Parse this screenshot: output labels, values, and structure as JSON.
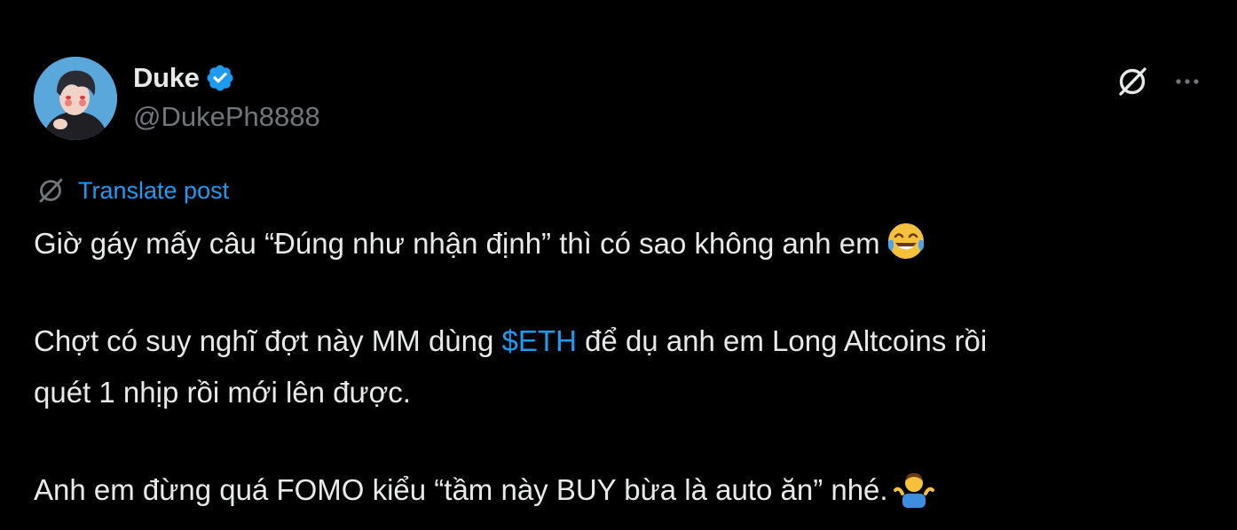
{
  "author": {
    "display_name": "Duke",
    "handle": "@DukePh8888",
    "verified": true
  },
  "actions": {
    "grok_icon": "grok-slash-icon",
    "more_icon": "more-horizontal-icon"
  },
  "translate": {
    "label": "Translate post"
  },
  "post": {
    "line1": "Giờ gáy mấy câu “Đúng như nhận định” thì có sao không anh em",
    "line2_before": "Chợt có suy nghĩ đợt này MM dùng ",
    "cashtag": "$ETH",
    "line2_after": " để dụ anh em Long Altcoins rồi",
    "line3": "quét 1 nhịp rồi mới lên được.",
    "line4": "Anh em đừng quá FOMO kiểu “tầm này BUY bừa là auto ăn” nhé."
  },
  "emojis": {
    "line1": "tears-of-joy-emoji",
    "line4": "shrugging-person-emoji"
  },
  "colors": {
    "background": "#000000",
    "text": "#e7e9ea",
    "secondary": "#71767b",
    "accent": "#1d9bf0"
  }
}
